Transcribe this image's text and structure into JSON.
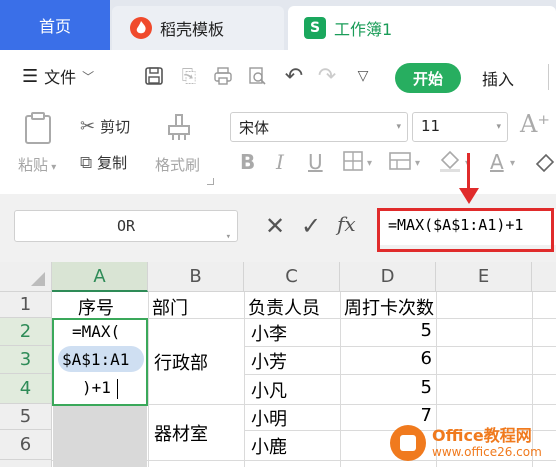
{
  "tabs": {
    "home": "首页",
    "daoke": "稻壳模板",
    "workbook": "工作簿1"
  },
  "menu": {
    "file": "文件",
    "start": "开始",
    "insert": "插入"
  },
  "ribbon": {
    "paste": "粘贴",
    "cut": "剪切",
    "copy": "复制",
    "format_painter": "格式刷",
    "font_name": "宋体",
    "font_size": "11",
    "bold": "B",
    "italic": "I",
    "underline": "U",
    "font_color": "A",
    "grow_font": "A⁺"
  },
  "formula_bar": {
    "name_box": "OR",
    "cancel": "✕",
    "confirm": "✓",
    "fx": "fx",
    "formula": "=MAX($A$1:A1)+1"
  },
  "columns": [
    "A",
    "B",
    "C",
    "D",
    "E"
  ],
  "rows": [
    "1",
    "2",
    "3",
    "4",
    "5",
    "6"
  ],
  "sheet": {
    "header": {
      "a": "序号",
      "b": "部门",
      "c": "负责人员",
      "d": "周打卡次数"
    },
    "a_edit": [
      "=MAX(",
      "$A$1:A1",
      ")+1"
    ],
    "b": {
      "r2to4": "行政部",
      "r5to6": "器材室"
    },
    "c": [
      "小李",
      "小芳",
      "小凡",
      "小明",
      "小鹿"
    ],
    "d": [
      "5",
      "6",
      "5",
      "7"
    ]
  },
  "watermark": {
    "title": "Office教程网",
    "url": "www.office26.com"
  },
  "colors": {
    "accent_green": "#27ae60",
    "tab_blue": "#3a6fe8",
    "highlight_red": "#e02b2b",
    "watermark_orange": "#f07a1e"
  }
}
